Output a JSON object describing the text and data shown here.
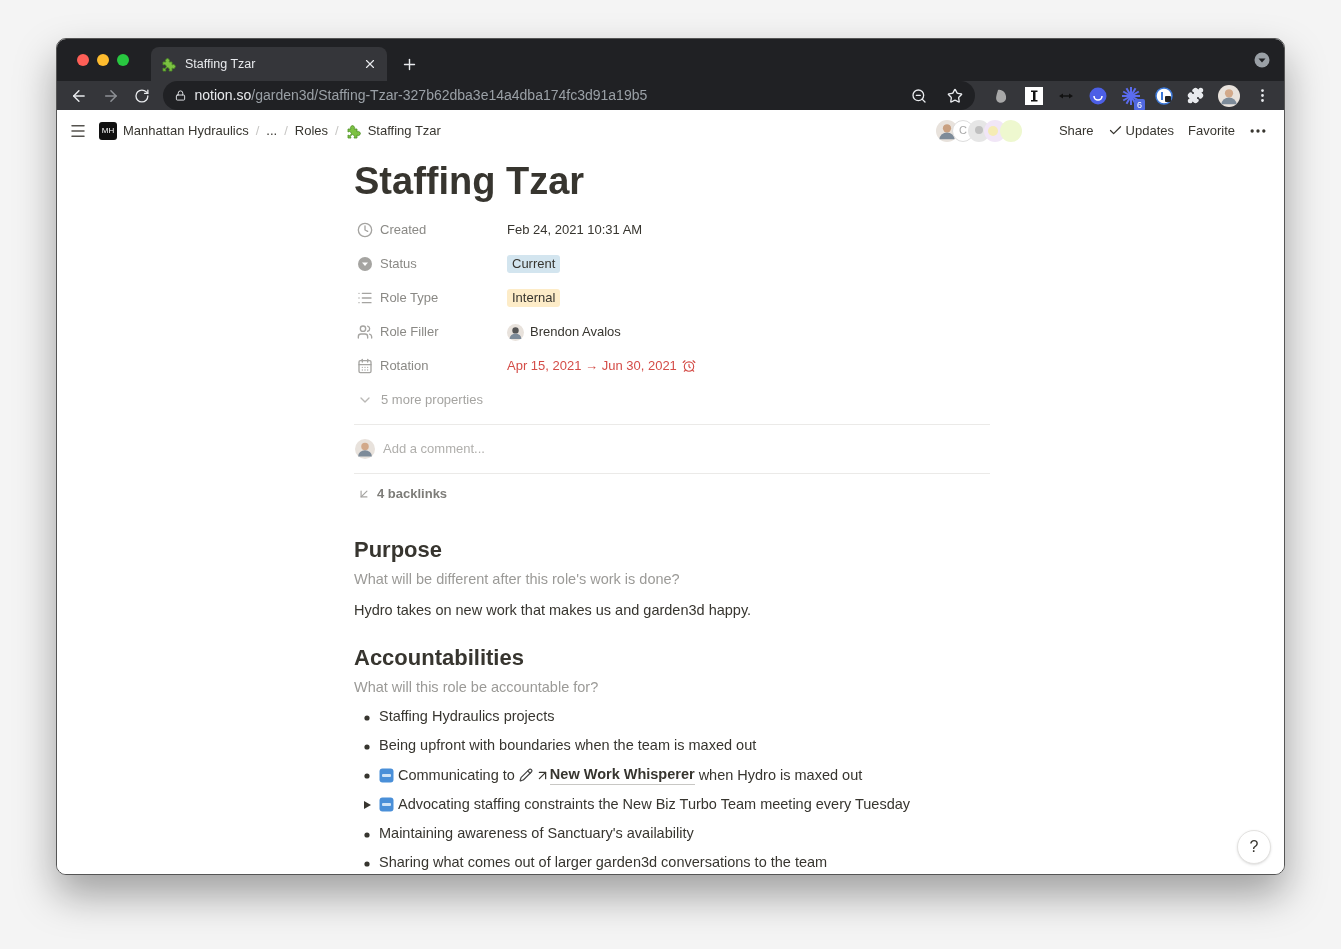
{
  "browser": {
    "tab": {
      "title": "Staffing Tzar",
      "selected": true
    },
    "url": {
      "host": "notion.so",
      "path": "/garden3d/Staffing-Tzar-327b62dba3e14a4dba174fc3d91a19b5"
    },
    "extension_badge": "6"
  },
  "topbar": {
    "separator": "/",
    "breadcrumbs": [
      {
        "label": "Manhattan Hydraulics",
        "kind": "workspace",
        "logo": "MH"
      },
      {
        "label": "...",
        "kind": "plain"
      },
      {
        "label": "Roles",
        "kind": "plain"
      },
      {
        "label": "Staffing Tzar",
        "kind": "page"
      }
    ],
    "actions": [
      {
        "label": "Share",
        "checked": false
      },
      {
        "label": "Updates",
        "checked": true
      },
      {
        "label": "Favorite",
        "checked": false
      }
    ],
    "collaborator_initial": "C"
  },
  "page": {
    "title": "Staffing Tzar",
    "properties": [
      {
        "name": "Created",
        "kind": "text",
        "value": "Feb 24, 2021 10:31 AM"
      },
      {
        "name": "Status",
        "kind": "tag",
        "value": "Current",
        "color": "#d3e5ef"
      },
      {
        "name": "Role Type",
        "kind": "tag",
        "value": "Internal",
        "color": "#fdecc8"
      },
      {
        "name": "Role Filler",
        "kind": "person",
        "value": "Brendon Avalos"
      },
      {
        "name": "Rotation",
        "kind": "reminder",
        "value": "Apr 15, 2021 → Jun 30, 2021"
      }
    ],
    "more_properties": "5 more properties",
    "comment": {
      "placeholder": "Add a comment..."
    },
    "backlinks": "4 backlinks",
    "sections": [
      {
        "heading": "Purpose",
        "prompt": "What will be different after this role's work is done?",
        "paragraph": "Hydro takes on new work that makes us and garden3d happy."
      },
      {
        "heading": "Accountabilities",
        "prompt": "What will this role be accountable for?",
        "items": [
          {
            "kind": "bullet",
            "new": false,
            "parts": [
              {
                "kind": "text",
                "text": "Staffing Hydraulics projects"
              }
            ]
          },
          {
            "kind": "bullet",
            "new": false,
            "parts": [
              {
                "kind": "text",
                "text": "Being upfront with boundaries when the team is maxed out"
              }
            ]
          },
          {
            "kind": "bullet",
            "new": true,
            "parts": [
              {
                "kind": "text",
                "text": "Communicating to"
              },
              {
                "kind": "page_link",
                "text": "New Work Whisperer"
              },
              {
                "kind": "text",
                "text": "when Hydro is maxed out"
              }
            ]
          },
          {
            "kind": "toggle",
            "new": true,
            "expanded": false,
            "parts": [
              {
                "kind": "text",
                "text": "Advocating staffing constraints the New Biz Turbo Team meeting every Tuesday"
              }
            ]
          },
          {
            "kind": "bullet",
            "new": false,
            "parts": [
              {
                "kind": "text",
                "text": "Maintaining awareness of Sanctuary's availability"
              }
            ]
          },
          {
            "kind": "bullet",
            "new": false,
            "parts": [
              {
                "kind": "text",
                "text": "Sharing what comes out of larger garden3d conversations to the team"
              }
            ]
          }
        ]
      }
    ]
  },
  "help": "?"
}
